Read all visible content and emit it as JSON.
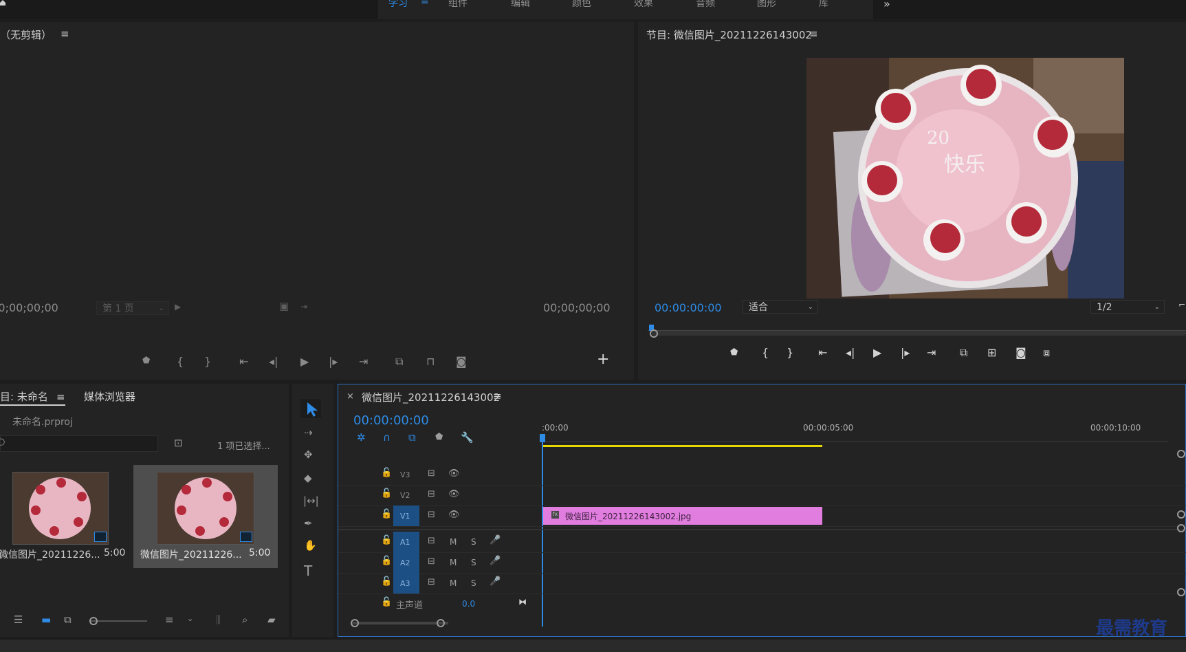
{
  "workspace_menu": {
    "items": [
      "学习",
      "组件",
      "编辑",
      "颜色",
      "效果",
      "音频",
      "图形",
      "库"
    ],
    "active_icon": "≡",
    "more": "»"
  },
  "source_monitor": {
    "title": "（无剪辑）",
    "menu_icon": "≡",
    "timecode_left": ";0;00;00;00",
    "timecode_right": "00;00;00;00",
    "page_dropdown": "第 1 页",
    "add_icon": "+"
  },
  "program_monitor": {
    "title": "节目: 微信图片_20211226143002",
    "menu_icon": "≡",
    "timecode": "00:00:00:00",
    "zoom": "适合",
    "resolution": "1/2"
  },
  "project_panel": {
    "tab_project": "目: 未命名",
    "tab_menu": "≡",
    "tab_media": "媒体浏览器",
    "project_file": "未命名.prproj",
    "selection_status": "1 项已选择...",
    "items": [
      {
        "name": "微信图片_20211226...",
        "duration": "5:00"
      },
      {
        "name": "微信图片_20211226...",
        "duration": "5:00"
      }
    ]
  },
  "timeline": {
    "close": "×",
    "sequence_name": "微信图片_20211226143002",
    "menu_icon": "≡",
    "timecode": "00:00:00:00",
    "ruler_labels": [
      ":00:00",
      "00:00:05:00",
      "00:00:10:00"
    ],
    "video_tracks": [
      "V3",
      "V2",
      "V1"
    ],
    "audio_tracks": [
      "A1",
      "A2",
      "A3"
    ],
    "mute": "M",
    "solo": "S",
    "master_label": "主声道",
    "master_value": "0.0",
    "clip_name": "微信图片_20211226143002.jpg",
    "clip_fx": "fx"
  },
  "watermark": "最需教育",
  "colors": {
    "accent": "#2e8be6",
    "clip": "#e07ddf",
    "work_area": "#e6d800",
    "panel_bg": "#232323",
    "track_target": "#1c4f84"
  }
}
